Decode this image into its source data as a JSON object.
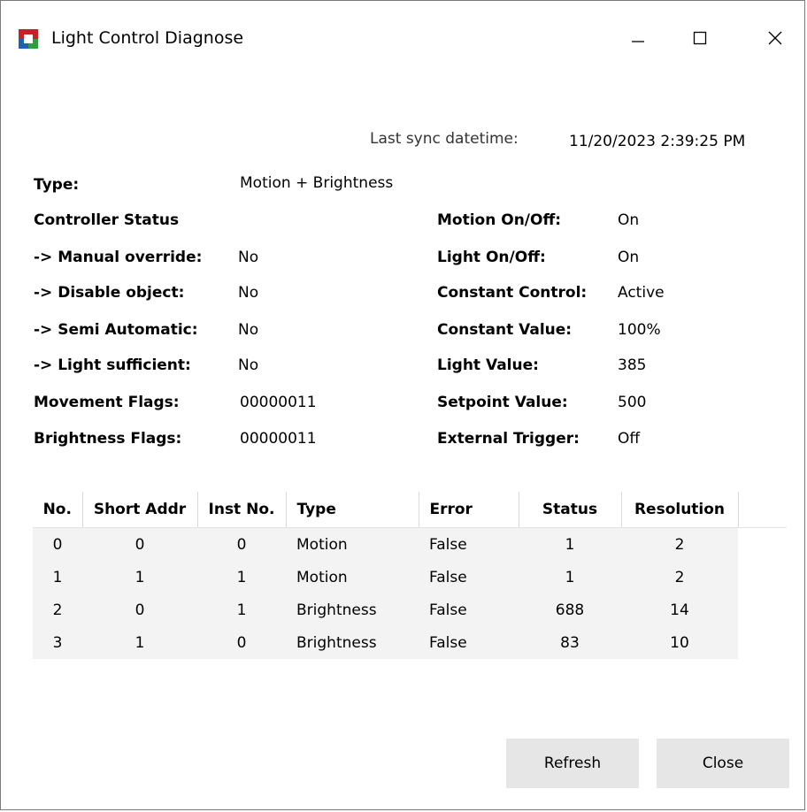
{
  "window": {
    "title": "Light Control Diagnose",
    "icon": "app-logo-icon",
    "controls": [
      "minimize-icon",
      "maximize-icon",
      "close-icon"
    ]
  },
  "sync": {
    "label": "Last sync datetime:",
    "value": "11/20/2023 2:39:25 PM"
  },
  "left_fields": [
    {
      "label": "Type:",
      "value": "Motion + Brightness"
    },
    {
      "label": "Controller Status",
      "value": ""
    },
    {
      "label": "-> Manual override:",
      "value": "No"
    },
    {
      "label": "-> Disable object:",
      "value": "No"
    },
    {
      "label": "-> Semi Automatic:",
      "value": "No"
    },
    {
      "label": "-> Light sufficient:",
      "value": "No"
    },
    {
      "label": "Movement Flags:",
      "value": "00000011"
    },
    {
      "label": "Brightness Flags:",
      "value": "00000011"
    }
  ],
  "right_fields": [
    {
      "label": "Motion On/Off:",
      "value": "On"
    },
    {
      "label": "Light On/Off:",
      "value": "On"
    },
    {
      "label": "Constant Control:",
      "value": "Active"
    },
    {
      "label": "Constant Value:",
      "value": "100%"
    },
    {
      "label": "Light Value:",
      "value": "385"
    },
    {
      "label": "Setpoint Value:",
      "value": "500"
    },
    {
      "label": "External Trigger:",
      "value": "Off"
    }
  ],
  "table": {
    "columns": [
      "No.",
      "Short Addr",
      "Inst No.",
      "Type",
      "Error",
      "Status",
      "Resolution"
    ],
    "rows": [
      [
        "0",
        "0",
        "0",
        "Motion",
        "False",
        "1",
        "2"
      ],
      [
        "1",
        "1",
        "1",
        "Motion",
        "False",
        "1",
        "2"
      ],
      [
        "2",
        "0",
        "1",
        "Brightness",
        "False",
        "688",
        "14"
      ],
      [
        "3",
        "1",
        "0",
        "Brightness",
        "False",
        "83",
        "10"
      ]
    ]
  },
  "buttons": {
    "refresh": "Refresh",
    "close": "Close"
  },
  "colors": {
    "button_bg": "#e6e6e6",
    "row_bg": "#f3f3f3",
    "border": "#7a7a7a"
  }
}
